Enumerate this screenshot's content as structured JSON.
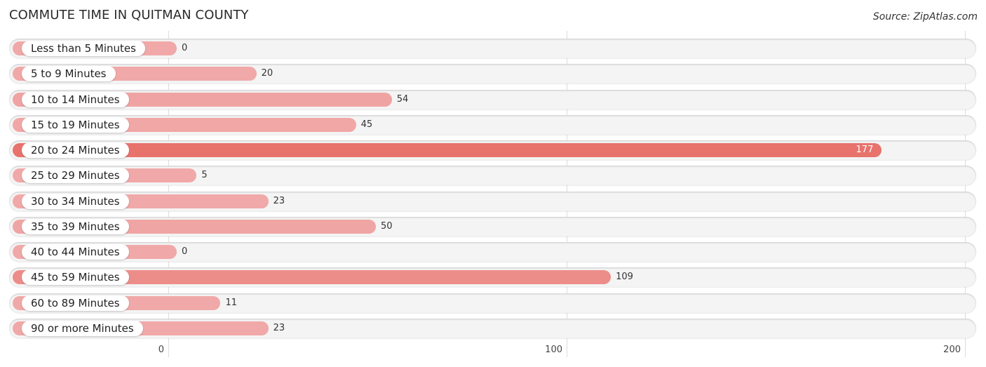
{
  "title": "COMMUTE TIME IN QUITMAN COUNTY",
  "source": "Source: ZipAtlas.com",
  "chart_data": {
    "type": "bar",
    "orientation": "horizontal",
    "title": "COMMUTE TIME IN QUITMAN COUNTY",
    "xlabel": "",
    "ylabel": "",
    "xlim": [
      0,
      200
    ],
    "grid": true,
    "ticks": [
      0,
      100,
      200
    ],
    "tick_labels": [
      "0",
      "100",
      "200"
    ],
    "categories": [
      "Less than 5 Minutes",
      "5 to 9 Minutes",
      "10 to 14 Minutes",
      "15 to 19 Minutes",
      "20 to 24 Minutes",
      "25 to 29 Minutes",
      "30 to 34 Minutes",
      "35 to 39 Minutes",
      "40 to 44 Minutes",
      "45 to 59 Minutes",
      "60 to 89 Minutes",
      "90 or more Minutes"
    ],
    "values": [
      0,
      20,
      54,
      45,
      177,
      5,
      23,
      50,
      0,
      109,
      11,
      23
    ],
    "colors": {
      "light": "#f0a9a8",
      "dark": "#e8726c",
      "track": "#f4f4f4"
    }
  }
}
